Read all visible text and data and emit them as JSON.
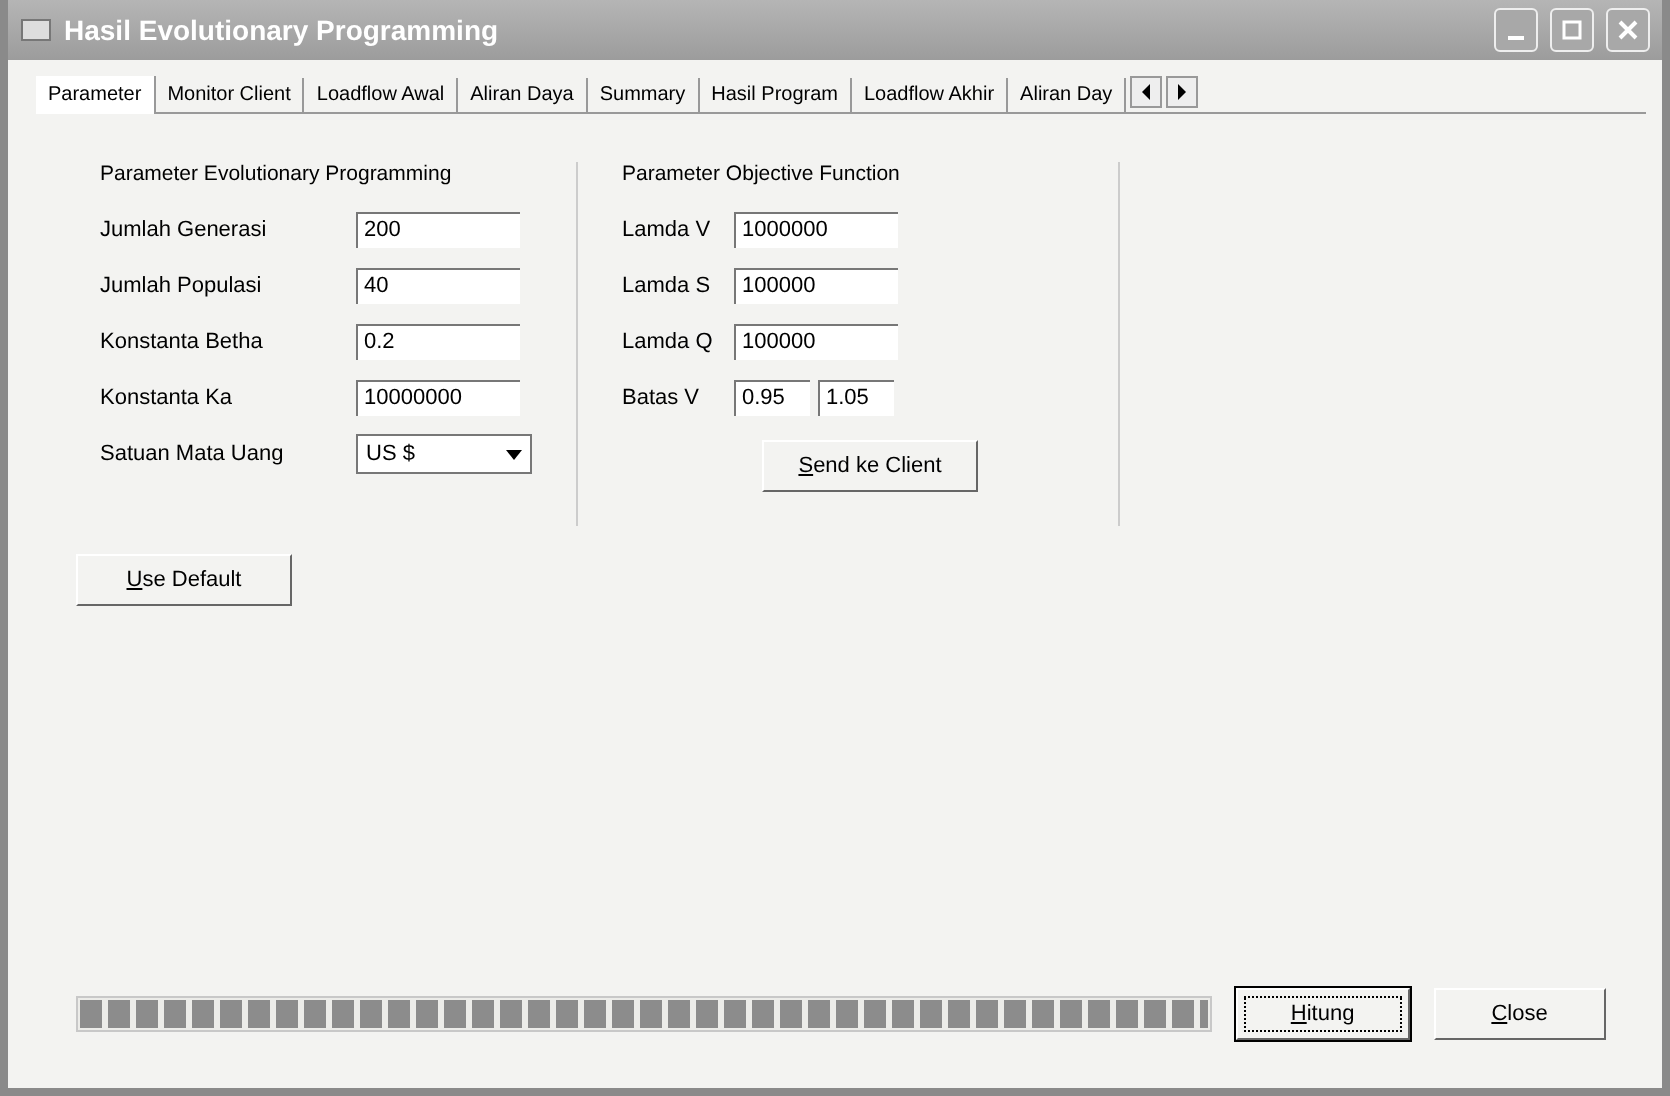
{
  "window": {
    "title": "Hasil Evolutionary Programming"
  },
  "tabs": [
    {
      "label": "Parameter",
      "selected": true
    },
    {
      "label": "Monitor Client",
      "selected": false
    },
    {
      "label": "Loadflow Awal",
      "selected": false
    },
    {
      "label": "Aliran Daya",
      "selected": false
    },
    {
      "label": "Summary",
      "selected": false
    },
    {
      "label": "Hasil Program",
      "selected": false
    },
    {
      "label": "Loadflow Akhir",
      "selected": false
    },
    {
      "label": "Aliran Day",
      "selected": false
    }
  ],
  "ep_group": {
    "title": "Parameter Evolutionary Programming",
    "fields": [
      {
        "label": "Jumlah Generasi",
        "value": "200",
        "kind": "text"
      },
      {
        "label": "Jumlah Populasi",
        "value": "40",
        "kind": "text"
      },
      {
        "label": "Konstanta Betha",
        "value": "0.2",
        "kind": "text"
      },
      {
        "label": "Konstanta Ka",
        "value": "10000000",
        "kind": "text"
      },
      {
        "label": "Satuan Mata Uang",
        "value": "US $",
        "kind": "dropdown"
      }
    ]
  },
  "of_group": {
    "title": "Parameter Objective Function",
    "fields": [
      {
        "label": "Lamda V",
        "values": [
          "1000000"
        ]
      },
      {
        "label": "Lamda S",
        "values": [
          "100000"
        ]
      },
      {
        "label": "Lamda Q",
        "values": [
          "100000"
        ]
      },
      {
        "label": "Batas V",
        "values": [
          "0.95",
          "1.05"
        ]
      }
    ],
    "button": "Send ke Client"
  },
  "default_button": "Use Default",
  "progress": {
    "level": 1
  },
  "buttons": [
    {
      "label": "Hitung",
      "focused": true
    },
    {
      "label": "Close",
      "focused": false
    }
  ]
}
